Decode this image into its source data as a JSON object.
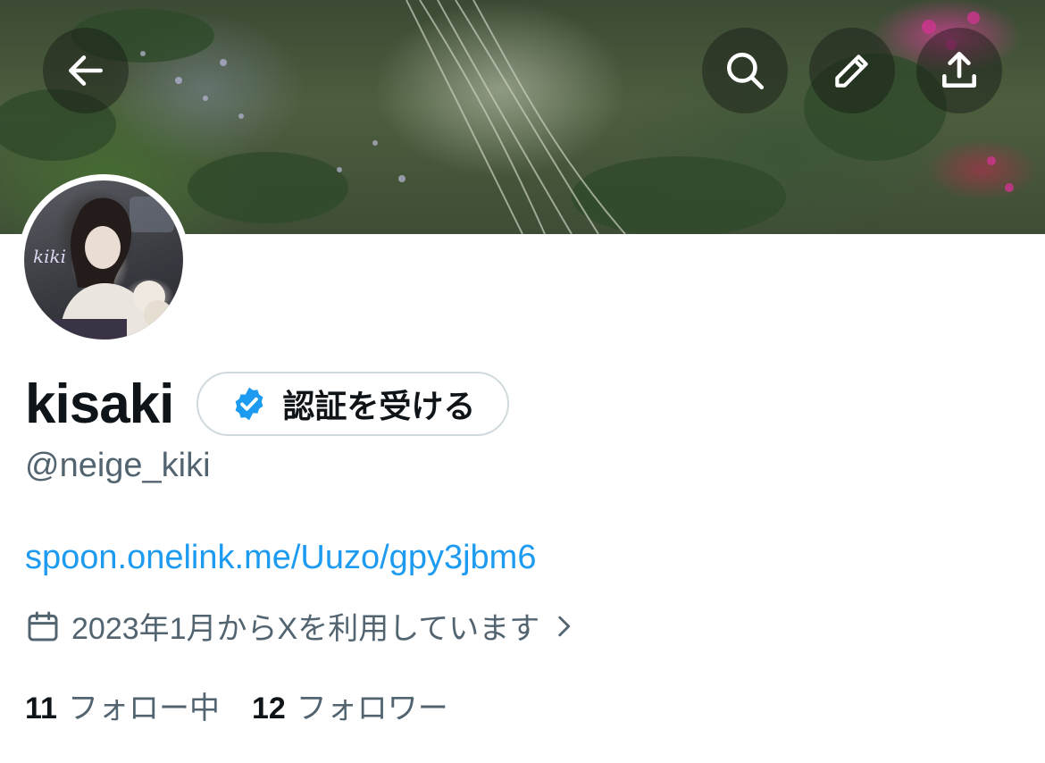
{
  "header": {
    "back_icon": "arrow-left-icon",
    "search_icon": "search-icon",
    "edit_icon": "pencil-icon",
    "share_icon": "share-upload-icon"
  },
  "profile": {
    "display_name": "kisaki",
    "verify_label": "認証を受ける",
    "verify_icon": "verified-badge-icon",
    "handle": "@neige_kiki",
    "link": "spoon.onelink.me/Uuzo/gpy3jbm6",
    "joined": "2023年1月からXを利用しています",
    "joined_icon": "calendar-icon"
  },
  "stats": {
    "following_count": "11",
    "following_label": "フォロー中",
    "followers_count": "12",
    "followers_label": "フォロワー"
  },
  "colors": {
    "accent": "#1d9bf0",
    "text_primary": "#0f1419",
    "text_secondary": "#536471",
    "border": "#cfd9de"
  }
}
